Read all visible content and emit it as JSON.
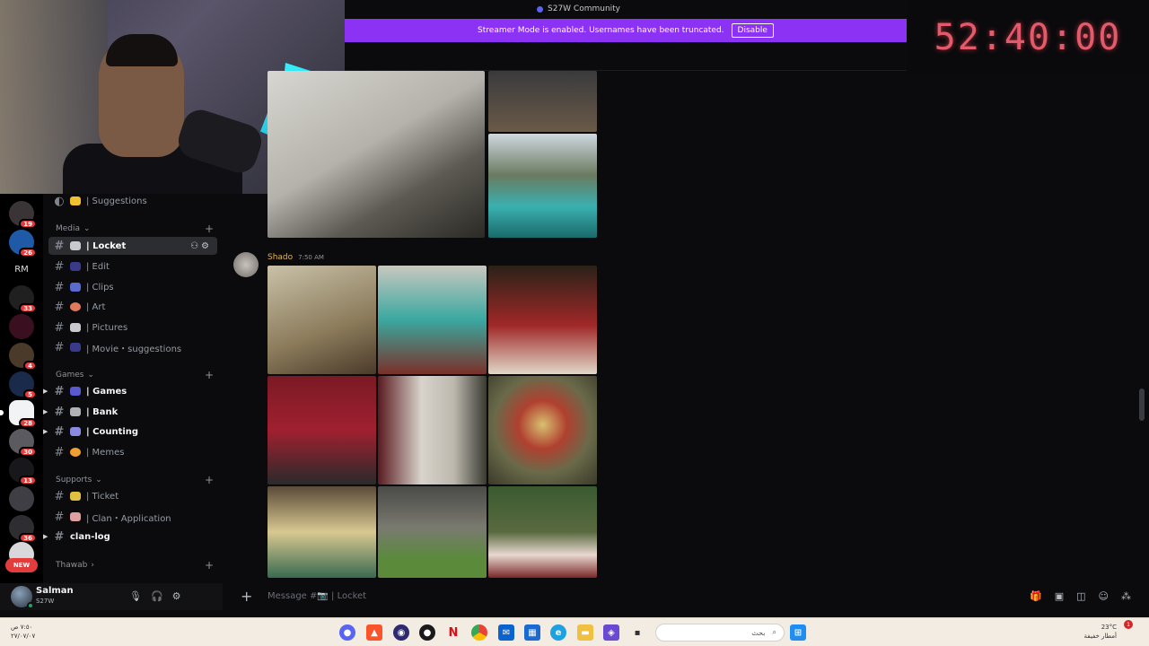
{
  "window": {
    "title": "S27W Community"
  },
  "banner": {
    "text": "Streamer Mode is enabled. Usernames have been truncated.",
    "button": "Disable"
  },
  "timer": {
    "value": "52:40:00"
  },
  "servers": [
    {
      "label": "",
      "badge": "19"
    },
    {
      "label": "",
      "badge": "26"
    },
    {
      "label": "RM",
      "badge": ""
    },
    {
      "label": "",
      "badge": "33"
    },
    {
      "label": "",
      "badge": ""
    },
    {
      "label": "",
      "badge": "4"
    },
    {
      "label": "",
      "badge": "5"
    },
    {
      "label": "",
      "badge": "28"
    },
    {
      "label": "",
      "badge": "30"
    },
    {
      "label": "",
      "badge": "13"
    },
    {
      "label": "",
      "badge": ""
    },
    {
      "label": "",
      "badge": "36"
    }
  ],
  "new_pill": "NEW",
  "channels": {
    "top_item": "| Suggestions",
    "categories": {
      "media": "Media",
      "games": "Games",
      "supports": "Supports",
      "thawab": "Thawab"
    },
    "items": {
      "locket": "| Locket",
      "edit": "| Edit",
      "clips": "| Clips",
      "art": "| Art",
      "pictures": "| Pictures",
      "movie": "| Movie・suggestions",
      "games": "| Games",
      "bank": "| Bank",
      "counting": "| Counting",
      "memes": "| Memes",
      "ticket": "| Ticket",
      "clan_app": "| Clan・Application",
      "clan_log": "clan-log"
    }
  },
  "user": {
    "name": "Salman",
    "tag": "S27W"
  },
  "message": {
    "author": "Shado",
    "timestamp": "7:50 AM"
  },
  "composer": {
    "placeholder": "Message #📷 | Locket"
  },
  "taskbar": {
    "clock_time": "٧:٥٠ ص",
    "clock_date": "٢٧/٠٧/٠٧",
    "search_text": "بحث",
    "weather_temp": "23°C",
    "weather_desc": "أمطار خفيفة",
    "notif_count": "1"
  },
  "colors": {
    "accent": "#8b32f5",
    "timer": "#e35a6a",
    "badge": "#e23c3c"
  }
}
